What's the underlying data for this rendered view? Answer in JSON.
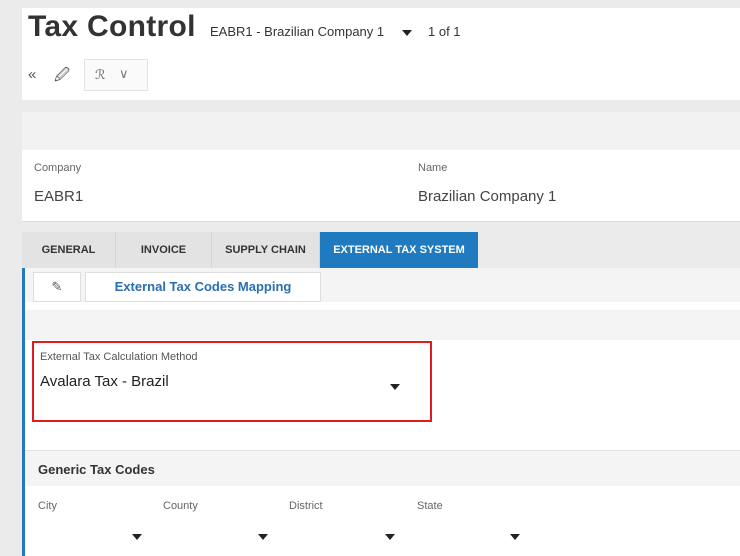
{
  "header": {
    "title": "Tax Control",
    "record_label": "EABR1 - Brazilian Company 1",
    "record_count": "1 of 1",
    "toolbar": {
      "collapse_icon": "«",
      "attach_icon": "🖉",
      "actions_icon": "ℛ",
      "actions_chevron": "∨"
    }
  },
  "summary": {
    "company_label": "Company",
    "company_value": "EABR1",
    "name_label": "Name",
    "name_value": "Brazilian Company 1"
  },
  "tabs": [
    {
      "label": "GENERAL",
      "active": false
    },
    {
      "label": "INVOICE",
      "active": false
    },
    {
      "label": "SUPPLY CHAIN",
      "active": false
    },
    {
      "label": "EXTERNAL TAX SYSTEM",
      "active": true
    }
  ],
  "external_tax": {
    "edit_icon": "✎",
    "mapping_button": "External Tax Codes Mapping",
    "method_label": "External Tax Calculation Method",
    "method_value": "Avalara Tax - Brazil"
  },
  "generic_tax_codes": {
    "title": "Generic Tax Codes",
    "fields": [
      {
        "label": "City",
        "value": ""
      },
      {
        "label": "County",
        "value": ""
      },
      {
        "label": "District",
        "value": ""
      },
      {
        "label": "State",
        "value": ""
      }
    ]
  },
  "colors": {
    "accent": "#1f7ac0",
    "highlight": "#e01b22",
    "link": "#2a6fb0"
  }
}
